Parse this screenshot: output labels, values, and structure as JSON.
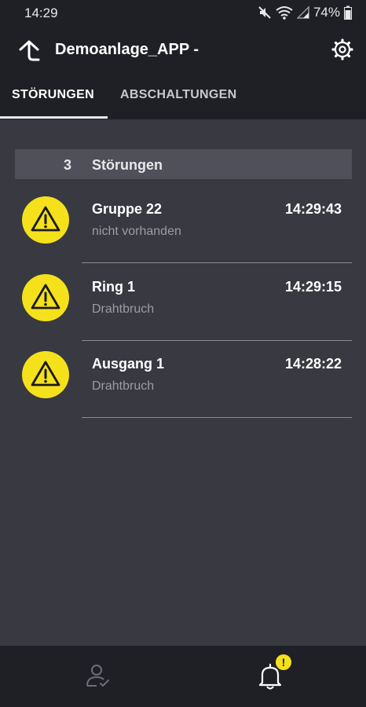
{
  "status_bar": {
    "time": "14:29",
    "battery": "74%",
    "icons": [
      "mute-icon",
      "wifi-icon",
      "signal-icon",
      "battery-icon"
    ]
  },
  "app_bar": {
    "title": "Demoanlage_APP -",
    "up_icon": "up-arrow-icon",
    "settings_icon": "gear-icon"
  },
  "tabs": [
    {
      "label": "STÖRUNGEN",
      "active": true
    },
    {
      "label": "ABSCHALTUNGEN",
      "active": false
    }
  ],
  "section": {
    "count": "3",
    "label": "Störungen"
  },
  "faults": [
    {
      "title": "Gruppe 22",
      "time": "14:29:43",
      "subtitle": "nicht vorhanden",
      "icon": "warning-icon"
    },
    {
      "title": "Ring 1",
      "time": "14:29:15",
      "subtitle": "Drahtbruch",
      "icon": "warning-icon"
    },
    {
      "title": "Ausgang 1",
      "time": "14:28:22",
      "subtitle": "Drahtbruch",
      "icon": "warning-icon"
    }
  ],
  "bottom_nav": {
    "user_icon": "user-check-icon",
    "bell_icon": "bell-icon",
    "badge": "!"
  },
  "colors": {
    "background": "#383941",
    "bar": "#1f2026",
    "section_header": "#4f5059",
    "warning": "#f5e11b"
  }
}
